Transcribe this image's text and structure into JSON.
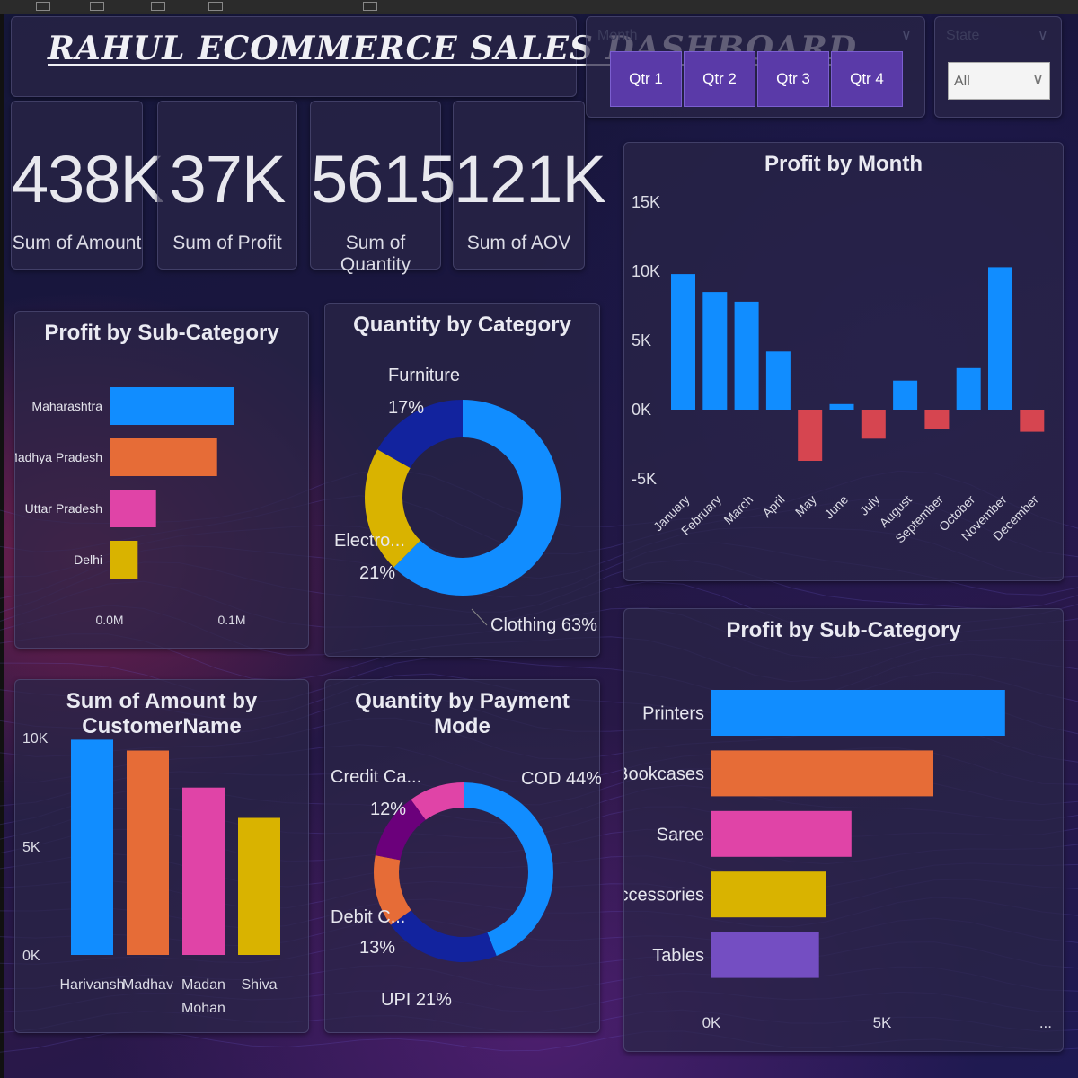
{
  "header": {
    "title": "RAHUL ECOMMERCE SALES DASHBOARD"
  },
  "slicers": {
    "quarter": {
      "label": "Month",
      "options": [
        "Qtr 1",
        "Qtr 2",
        "Qtr 3",
        "Qtr 4"
      ]
    },
    "state": {
      "label": "State",
      "selected": "All"
    }
  },
  "kpis": [
    {
      "value": "438K",
      "label": "Sum of Amount"
    },
    {
      "value": "37K",
      "label": "Sum of Profit"
    },
    {
      "value": "5615",
      "label": "Sum of Quantity"
    },
    {
      "value": "121K",
      "label": "Sum of AOV"
    }
  ],
  "chart_data": [
    {
      "id": "profit-by-state",
      "type": "bar",
      "orientation": "horizontal",
      "title": "Profit by Sub-Category",
      "categories": [
        "Maharashtra",
        "Madhya Pradesh",
        "Uttar Pradesh",
        "Delhi"
      ],
      "values": [
        0.102,
        0.088,
        0.038,
        0.023
      ],
      "colors": [
        "#118DFF",
        "#E66C37",
        "#E044A7",
        "#D9B300"
      ],
      "ticks": [
        "0.0M",
        "0.1M"
      ],
      "xlim": [
        0,
        0.1
      ]
    },
    {
      "id": "quantity-by-category",
      "type": "pie",
      "donut": true,
      "title": "Quantity by Category",
      "slices": [
        {
          "label": "Clothing",
          "pct_label": "63%",
          "value": 63,
          "color": "#118DFF"
        },
        {
          "label": "Electro...",
          "pct_label": "21%",
          "value": 21,
          "color": "#D9B300"
        },
        {
          "label": "Furniture",
          "pct_label": "17%",
          "value": 17,
          "color": "#12239E"
        }
      ]
    },
    {
      "id": "profit-by-month",
      "type": "bar",
      "title": "Profit by Month",
      "categories": [
        "January",
        "February",
        "March",
        "April",
        "May",
        "June",
        "July",
        "August",
        "September",
        "October",
        "November",
        "December"
      ],
      "values": [
        9800,
        8500,
        7800,
        4200,
        -3700,
        400,
        -2100,
        2100,
        -1400,
        3000,
        10300,
        -1600
      ],
      "positive_color": "#118DFF",
      "negative_color": "#D64550",
      "yticks": [
        15000,
        10000,
        5000,
        0,
        -5000
      ],
      "ytick_labels": [
        "15K",
        "10K",
        "5K",
        "0K",
        "-5K"
      ],
      "ylim": [
        -5000,
        15000
      ]
    },
    {
      "id": "amount-by-customer",
      "type": "bar",
      "title": "Sum of Amount by CustomerName",
      "categories": [
        "Harivansh",
        "Madhav",
        "Madan Mohan",
        "Shiva"
      ],
      "values": [
        9900,
        9400,
        7700,
        6300
      ],
      "colors": [
        "#118DFF",
        "#E66C37",
        "#E044A7",
        "#D9B300"
      ],
      "yticks": [
        10000,
        5000,
        0
      ],
      "ytick_labels": [
        "10K",
        "5K",
        "0K"
      ],
      "ylim": [
        0,
        10000
      ]
    },
    {
      "id": "quantity-by-payment",
      "type": "pie",
      "donut": true,
      "title": "Quantity by Payment Mode",
      "slices": [
        {
          "label": "COD",
          "pct_label": "44%",
          "value": 44,
          "color": "#118DFF"
        },
        {
          "label": "UPI",
          "pct_label": "21%",
          "value": 21,
          "color": "#12239E"
        },
        {
          "label": "Debit C...",
          "pct_label": "13%",
          "value": 13,
          "color": "#E66C37"
        },
        {
          "label": "Credit Ca...",
          "pct_label": "12%",
          "value": 12,
          "color": "#6B007B"
        },
        {
          "label": "",
          "pct_label": "",
          "value": 10,
          "color": "#E044A7"
        }
      ]
    },
    {
      "id": "profit-by-subcategory",
      "type": "bar",
      "orientation": "horizontal",
      "title": "Profit by Sub-Category",
      "categories": [
        "Printers",
        "Bookcases",
        "Saree",
        "Accessories",
        "Tables"
      ],
      "values": [
        8600,
        6500,
        4100,
        3350,
        3150
      ],
      "colors": [
        "#118DFF",
        "#E66C37",
        "#E044A7",
        "#D9B300",
        "#744EC2"
      ],
      "ticks": [
        0,
        5000
      ],
      "tick_labels": [
        "0K",
        "5K"
      ],
      "more_indicator": "...",
      "xlim": [
        0,
        5000
      ]
    }
  ]
}
